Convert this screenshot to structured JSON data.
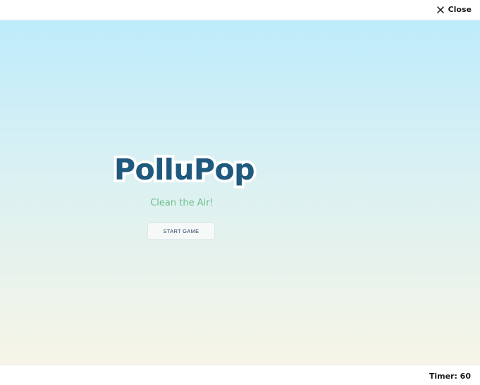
{
  "header": {
    "close_label": "Close",
    "close_icon": "close-icon"
  },
  "game": {
    "title": "PolluPop",
    "tagline": "Clean the Air!",
    "start_label": "START GAME",
    "colors": {
      "title": "#1f5a7e",
      "title_outline": "#ffffff",
      "tagline": "#6dbf8e",
      "sky_top": "#bdecfb",
      "sky_bottom": "#f6f4e6"
    }
  },
  "footer": {
    "timer_text": "Timer: 60"
  }
}
